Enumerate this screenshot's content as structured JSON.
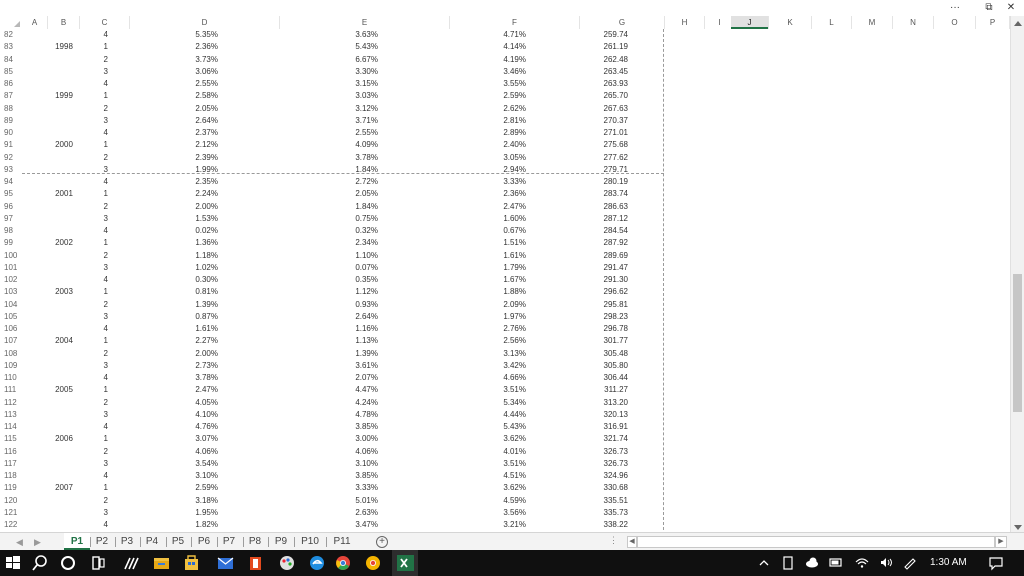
{
  "window": {
    "more_label": "···",
    "restore_label": "⧉",
    "close_label": "✕"
  },
  "columns": [
    "A",
    "B",
    "C",
    "D",
    "E",
    "F",
    "G",
    "H",
    "I",
    "J",
    "K",
    "L",
    "M",
    "N",
    "O",
    "P"
  ],
  "selected_column": "J",
  "rows": [
    {
      "n": "82",
      "b": "",
      "c": "4",
      "d": "5.35%",
      "e": "3.63%",
      "f": "4.71%",
      "g": "259.74"
    },
    {
      "n": "83",
      "b": "1998",
      "c": "1",
      "d": "2.36%",
      "e": "5.43%",
      "f": "4.14%",
      "g": "261.19"
    },
    {
      "n": "84",
      "b": "",
      "c": "2",
      "d": "3.73%",
      "e": "6.67%",
      "f": "4.19%",
      "g": "262.48"
    },
    {
      "n": "85",
      "b": "",
      "c": "3",
      "d": "3.06%",
      "e": "3.30%",
      "f": "3.46%",
      "g": "263.45"
    },
    {
      "n": "86",
      "b": "",
      "c": "4",
      "d": "2.55%",
      "e": "3.15%",
      "f": "3.55%",
      "g": "263.93"
    },
    {
      "n": "87",
      "b": "1999",
      "c": "1",
      "d": "2.58%",
      "e": "3.03%",
      "f": "2.59%",
      "g": "265.70"
    },
    {
      "n": "88",
      "b": "",
      "c": "2",
      "d": "2.05%",
      "e": "3.12%",
      "f": "2.62%",
      "g": "267.63"
    },
    {
      "n": "89",
      "b": "",
      "c": "3",
      "d": "2.64%",
      "e": "3.71%",
      "f": "2.81%",
      "g": "270.37"
    },
    {
      "n": "90",
      "b": "",
      "c": "4",
      "d": "2.37%",
      "e": "2.55%",
      "f": "2.89%",
      "g": "271.01"
    },
    {
      "n": "91",
      "b": "2000",
      "c": "1",
      "d": "2.12%",
      "e": "4.09%",
      "f": "2.40%",
      "g": "275.68"
    },
    {
      "n": "92",
      "b": "",
      "c": "2",
      "d": "2.39%",
      "e": "3.78%",
      "f": "3.05%",
      "g": "277.62"
    },
    {
      "n": "93",
      "b": "",
      "c": "3",
      "d": "1.99%",
      "e": "1.84%",
      "f": "2.94%",
      "g": "279.71"
    },
    {
      "n": "94",
      "b": "",
      "c": "4",
      "d": "2.35%",
      "e": "2.72%",
      "f": "3.33%",
      "g": "280.19"
    },
    {
      "n": "95",
      "b": "2001",
      "c": "1",
      "d": "2.24%",
      "e": "2.05%",
      "f": "2.36%",
      "g": "283.74"
    },
    {
      "n": "96",
      "b": "",
      "c": "2",
      "d": "2.00%",
      "e": "1.84%",
      "f": "2.47%",
      "g": "286.63"
    },
    {
      "n": "97",
      "b": "",
      "c": "3",
      "d": "1.53%",
      "e": "0.75%",
      "f": "1.60%",
      "g": "287.12"
    },
    {
      "n": "98",
      "b": "",
      "c": "4",
      "d": "0.02%",
      "e": "0.32%",
      "f": "0.67%",
      "g": "284.54"
    },
    {
      "n": "99",
      "b": "2002",
      "c": "1",
      "d": "1.36%",
      "e": "2.34%",
      "f": "1.51%",
      "g": "287.92"
    },
    {
      "n": "100",
      "b": "",
      "c": "2",
      "d": "1.18%",
      "e": "1.10%",
      "f": "1.61%",
      "g": "289.69"
    },
    {
      "n": "101",
      "b": "",
      "c": "3",
      "d": "1.02%",
      "e": "0.07%",
      "f": "1.79%",
      "g": "291.47"
    },
    {
      "n": "102",
      "b": "",
      "c": "4",
      "d": "0.30%",
      "e": "0.35%",
      "f": "1.67%",
      "g": "291.30"
    },
    {
      "n": "103",
      "b": "2003",
      "c": "1",
      "d": "0.81%",
      "e": "1.12%",
      "f": "1.88%",
      "g": "296.62"
    },
    {
      "n": "104",
      "b": "",
      "c": "2",
      "d": "1.39%",
      "e": "0.93%",
      "f": "2.09%",
      "g": "295.81"
    },
    {
      "n": "105",
      "b": "",
      "c": "3",
      "d": "0.87%",
      "e": "2.64%",
      "f": "1.97%",
      "g": "298.23"
    },
    {
      "n": "106",
      "b": "",
      "c": "4",
      "d": "1.61%",
      "e": "1.16%",
      "f": "2.76%",
      "g": "296.78"
    },
    {
      "n": "107",
      "b": "2004",
      "c": "1",
      "d": "2.27%",
      "e": "1.13%",
      "f": "2.56%",
      "g": "301.77"
    },
    {
      "n": "108",
      "b": "",
      "c": "2",
      "d": "2.00%",
      "e": "1.39%",
      "f": "3.13%",
      "g": "305.48"
    },
    {
      "n": "109",
      "b": "",
      "c": "3",
      "d": "2.73%",
      "e": "3.61%",
      "f": "3.42%",
      "g": "305.80"
    },
    {
      "n": "110",
      "b": "",
      "c": "4",
      "d": "3.78%",
      "e": "2.07%",
      "f": "4.66%",
      "g": "306.44"
    },
    {
      "n": "111",
      "b": "2005",
      "c": "1",
      "d": "2.47%",
      "e": "4.47%",
      "f": "3.51%",
      "g": "311.27"
    },
    {
      "n": "112",
      "b": "",
      "c": "2",
      "d": "4.05%",
      "e": "4.24%",
      "f": "5.34%",
      "g": "313.20"
    },
    {
      "n": "113",
      "b": "",
      "c": "3",
      "d": "4.10%",
      "e": "4.78%",
      "f": "4.44%",
      "g": "320.13"
    },
    {
      "n": "114",
      "b": "",
      "c": "4",
      "d": "4.76%",
      "e": "3.85%",
      "f": "5.43%",
      "g": "316.91"
    },
    {
      "n": "115",
      "b": "2006",
      "c": "1",
      "d": "3.07%",
      "e": "3.00%",
      "f": "3.62%",
      "g": "321.74"
    },
    {
      "n": "116",
      "b": "",
      "c": "2",
      "d": "4.06%",
      "e": "4.06%",
      "f": "4.01%",
      "g": "326.73"
    },
    {
      "n": "117",
      "b": "",
      "c": "3",
      "d": "3.54%",
      "e": "3.10%",
      "f": "3.51%",
      "g": "326.73"
    },
    {
      "n": "118",
      "b": "",
      "c": "4",
      "d": "3.10%",
      "e": "3.85%",
      "f": "4.51%",
      "g": "324.96"
    },
    {
      "n": "119",
      "b": "2007",
      "c": "1",
      "d": "2.59%",
      "e": "3.33%",
      "f": "3.62%",
      "g": "330.68"
    },
    {
      "n": "120",
      "b": "",
      "c": "2",
      "d": "3.18%",
      "e": "5.01%",
      "f": "4.59%",
      "g": "335.51"
    },
    {
      "n": "121",
      "b": "",
      "c": "3",
      "d": "1.95%",
      "e": "2.63%",
      "f": "3.56%",
      "g": "335.73"
    },
    {
      "n": "122",
      "b": "",
      "c": "4",
      "d": "1.82%",
      "e": "3.47%",
      "f": "3.21%",
      "g": "338.22"
    }
  ],
  "tabs": [
    "P1",
    "P2",
    "P3",
    "P4",
    "P5",
    "P6",
    "P7",
    "P8",
    "P9",
    "P10",
    "P11"
  ],
  "active_tab": "P1",
  "tab_nav": {
    "prev": "◀",
    "next": "▶"
  },
  "add_sheet_label": "+",
  "hscroll": {
    "dots": "⋮",
    "left": "◀",
    "right": "▶"
  },
  "taskbar": {
    "time": "1:30 AM",
    "items": [
      "windows-start-icon",
      "search-icon",
      "cortana-icon",
      "task-view-icon",
      "pen-icon",
      "file-explorer-icon",
      "store-icon",
      "mail-icon",
      "office-icon",
      "paint-icon",
      "edge-icon",
      "chrome-icon",
      "chrome-canary-icon",
      "excel-icon"
    ],
    "tray": [
      "chevron-up-icon",
      "tablet-icon",
      "onedrive-icon",
      "battery-icon",
      "wifi-icon",
      "volume-icon",
      "pen-tray-icon",
      "notification-icon"
    ]
  },
  "colors": {
    "accent": "#217346",
    "taskbar": "#101010"
  }
}
